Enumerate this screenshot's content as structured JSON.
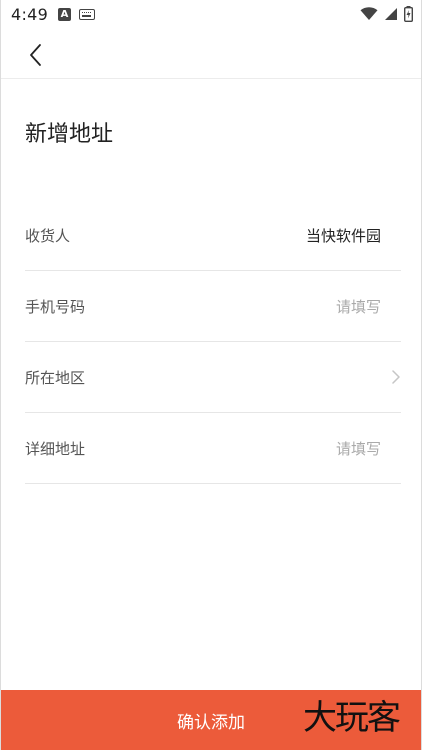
{
  "status_bar": {
    "time": "4:49",
    "left_icons": [
      "a-badge-icon",
      "keyboard-icon"
    ],
    "right_icons": [
      "wifi-icon",
      "cellular-signal-icon",
      "battery-icon"
    ]
  },
  "header": {
    "back_icon": "chevron-left-icon"
  },
  "page": {
    "title": "新增地址"
  },
  "form": {
    "rows": [
      {
        "label": "收货人",
        "value": "当快软件园",
        "placeholder": ""
      },
      {
        "label": "手机号码",
        "value": "",
        "placeholder": "请填写"
      },
      {
        "label": "所在地区",
        "value": "",
        "placeholder": ""
      },
      {
        "label": "详细地址",
        "value": "",
        "placeholder": "请填写"
      }
    ]
  },
  "submit": {
    "label": "确认添加",
    "color": "#ec5b3a"
  },
  "watermark": {
    "text": "大玩客"
  }
}
